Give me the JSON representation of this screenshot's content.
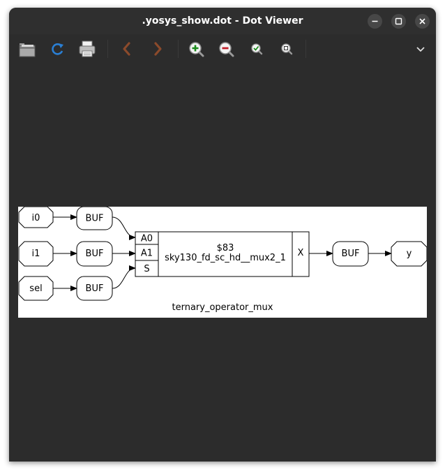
{
  "window": {
    "title": ".yosys_show.dot - Dot Viewer"
  },
  "window_controls": {
    "minimize_icon": "minimize-icon",
    "maximize_icon": "maximize-icon",
    "close_icon": "close-icon"
  },
  "toolbar": {
    "buttons": [
      {
        "name": "open-button",
        "icon": "folder-icon"
      },
      {
        "name": "reload-button",
        "icon": "reload-icon"
      },
      {
        "name": "print-button",
        "icon": "printer-icon"
      },
      {
        "name": "back-button",
        "icon": "chevron-left-icon"
      },
      {
        "name": "forward-button",
        "icon": "chevron-right-icon"
      },
      {
        "name": "zoom-in-button",
        "icon": "zoom-in-icon"
      },
      {
        "name": "zoom-out-button",
        "icon": "zoom-out-icon"
      },
      {
        "name": "zoom-fit-button",
        "icon": "zoom-fit-icon"
      },
      {
        "name": "zoom-100-button",
        "icon": "zoom-100-icon"
      },
      {
        "name": "menu-button",
        "icon": "chevron-down-icon"
      }
    ]
  },
  "graph": {
    "inputs": {
      "i0": "i0",
      "i1": "i1",
      "sel": "sel"
    },
    "buffers": {
      "buf_i0": "BUF",
      "buf_i1": "BUF",
      "buf_sel": "BUF",
      "buf_out": "BUF"
    },
    "cell": {
      "id": "$83",
      "type": "sky130_fd_sc_hd__mux2_1",
      "ports_in": [
        "A0",
        "A1",
        "S"
      ],
      "port_out": "X"
    },
    "output": "y",
    "module_name": "ternary_operator_mux"
  },
  "colors": {
    "window_bg": "#2c2c2c",
    "graph_bg": "#ffffff",
    "reload_blue": "#2a7fd4",
    "nav_brown": "#8b4a2b",
    "zoom_green": "#1a8a1a",
    "zoom_red": "#c01c28"
  }
}
